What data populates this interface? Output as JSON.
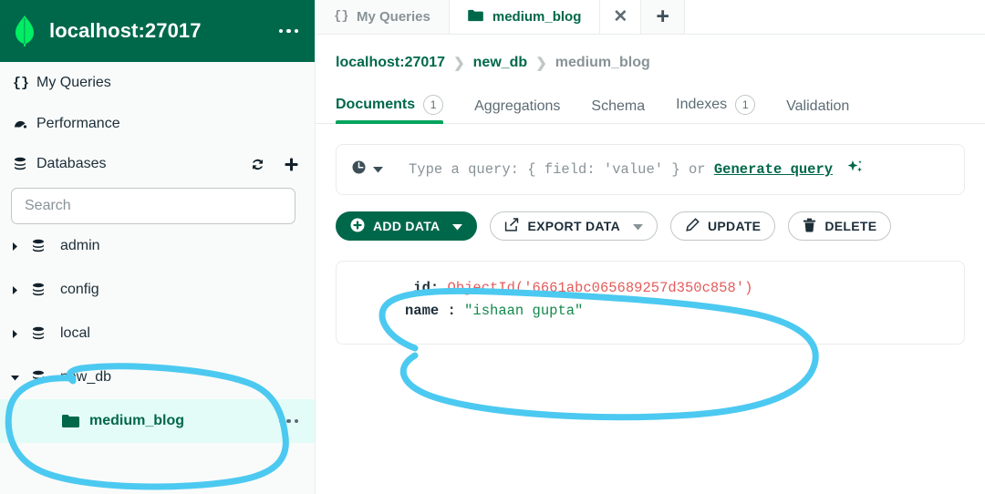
{
  "sidebar": {
    "connection": {
      "title": "localhost:27017",
      "menu_icon": "ellipsis-icon",
      "logo": "mongodb-leaf-icon"
    },
    "nav": [
      {
        "label": "My Queries",
        "icon": "braces-icon"
      },
      {
        "label": "Performance",
        "icon": "gauge-icon"
      }
    ],
    "databases_section": {
      "label": "Databases",
      "icon": "database-icon",
      "refresh_icon": "refresh-icon",
      "add_icon": "plus-icon"
    },
    "search": {
      "placeholder": "Search",
      "value": ""
    },
    "tree": [
      {
        "label": "admin",
        "expanded": false,
        "icon": "database-icon"
      },
      {
        "label": "config",
        "expanded": false,
        "icon": "database-icon"
      },
      {
        "label": "local",
        "expanded": false,
        "icon": "database-icon"
      },
      {
        "label": "new_db",
        "expanded": true,
        "icon": "database-icon"
      }
    ],
    "collection": {
      "label": "medium_blog",
      "icon": "folder-icon",
      "menu_icon": "ellipsis-icon",
      "selected": true
    }
  },
  "tabbar": {
    "tabs": [
      {
        "label": "My Queries",
        "icon": "braces-icon",
        "active": false
      },
      {
        "label": "medium_blog",
        "icon": "folder-icon",
        "active": true
      }
    ],
    "close_label": "✕",
    "new_tab_label": "+"
  },
  "breadcrumb": {
    "items": [
      "localhost:27017",
      "new_db",
      "medium_blog"
    ],
    "separator": "❯"
  },
  "subtabs": [
    {
      "label": "Documents",
      "badge": "1",
      "active": true
    },
    {
      "label": "Aggregations",
      "badge": "",
      "active": false
    },
    {
      "label": "Schema",
      "badge": "",
      "active": false
    },
    {
      "label": "Indexes",
      "badge": "1",
      "active": false
    },
    {
      "label": "Validation",
      "badge": "",
      "active": false
    }
  ],
  "querybar": {
    "history_icon": "clock-icon",
    "caret_icon": "chevron-down-icon",
    "placeholder_prefix": "Type a query: { field: 'value' } or ",
    "generate_link": "Generate query",
    "sparkle_icon": "sparkle-icon"
  },
  "actions": [
    {
      "label": "ADD DATA",
      "icon": "plus-circle-icon",
      "caret": true,
      "style": "primary"
    },
    {
      "label": "EXPORT DATA",
      "icon": "export-icon",
      "caret": true,
      "style": "ghost"
    },
    {
      "label": "UPDATE",
      "icon": "pencil-icon",
      "caret": false,
      "style": "ghost"
    },
    {
      "label": "DELETE",
      "icon": "trash-icon",
      "caret": false,
      "style": "ghost"
    }
  ],
  "document": {
    "id_key": "_id:",
    "id_value": "ObjectId('6661abc065689257d350c858')",
    "name_key": "name :",
    "name_value": "\"ishaan gupta\""
  },
  "colors": {
    "brand_dark_green": "#00684a",
    "brand_green": "#00a35c",
    "leaf_green": "#00ed64",
    "selected_row": "#e3fcf7",
    "annotation": "#4cc9f0",
    "string_green": "#13884b",
    "objectid_red": "#e45b5b"
  }
}
